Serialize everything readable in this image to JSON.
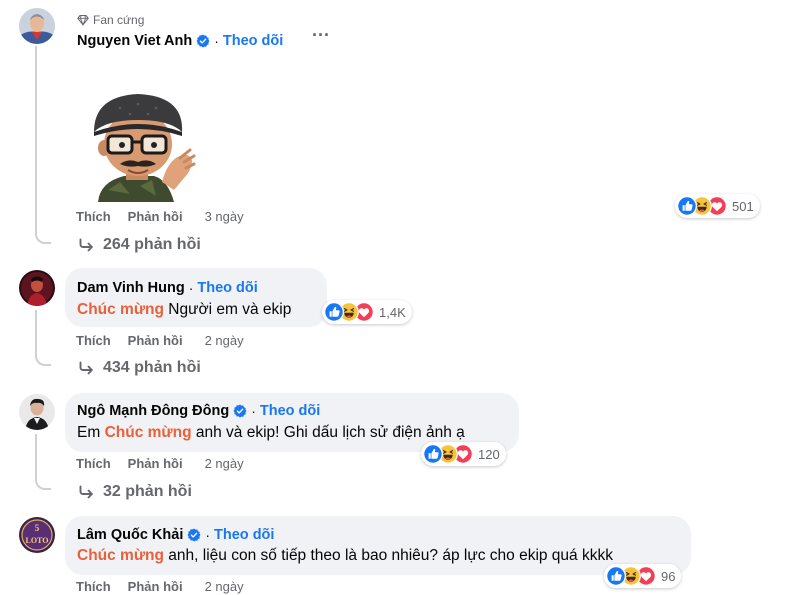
{
  "icons": {
    "like": "like-icon",
    "haha": "haha-icon",
    "love": "love-icon",
    "verified": "verified-icon",
    "reply_arrow": "reply-arrow-icon",
    "more": "more-options-icon",
    "diamond": "diamond-icon"
  },
  "colors": {
    "link_blue": "#1877f2",
    "highlight": "#e9603a",
    "bubble": "#f0f2f5",
    "muted": "#65676b"
  },
  "comments": [
    {
      "badge": "Fan cứng",
      "author": "Nguyen Viet Anh",
      "verified": true,
      "follow": "Theo dõi",
      "more": "...",
      "sticker": "avatar-sticker",
      "like": "Thích",
      "reply": "Phản hồi",
      "time": "3 ngày",
      "reactions": "501",
      "replies": "264 phản hồi"
    },
    {
      "author": "Dam Vinh Hung",
      "follow": "Theo dõi",
      "highlight": "Chúc mừng",
      "text": " Người em và ekip",
      "like": "Thích",
      "reply": "Phản hồi",
      "time": "2 ngày",
      "reactions": "1,4K",
      "replies": "434 phản hồi"
    },
    {
      "author": "Ngô Mạnh Đông Đông",
      "verified": true,
      "follow": "Theo dõi",
      "text_before": "Em ",
      "highlight": "Chúc mừng",
      "text": " anh và ekip! Ghi dấu lịch sử điện ảnh ạ",
      "like": "Thích",
      "reply": "Phản hồi",
      "time": "2 ngày",
      "reactions": "120",
      "replies": "32 phản hồi"
    },
    {
      "author": "Lâm Quốc Khải",
      "verified": true,
      "follow": "Theo dõi",
      "highlight": "Chúc mừng",
      "text": " anh, liệu con số tiếp theo là bao nhiêu? áp lực cho ekip quá kkkk",
      "like": "Thích",
      "reply": "Phản hồi",
      "time": "2 ngày",
      "reactions": "96",
      "avatar_text": "5 LOTO"
    }
  ]
}
